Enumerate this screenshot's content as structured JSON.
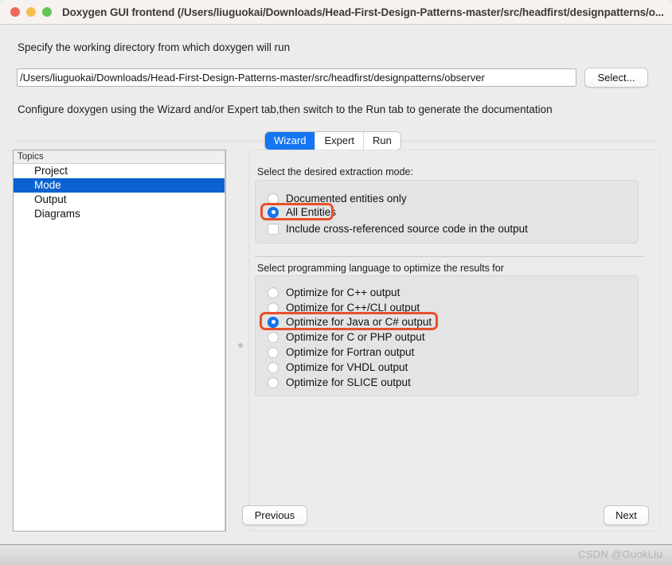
{
  "window": {
    "title": "Doxygen GUI frontend (/Users/liuguokai/Downloads/Head-First-Design-Patterns-master/src/headfirst/designpatterns/o...",
    "traffic_lights": [
      "close-red",
      "minimize-yellow",
      "maximize-green"
    ]
  },
  "form": {
    "directory_label": "Specify the working directory from which doxygen will run",
    "directory_value": "/Users/liuguokai/Downloads/Head-First-Design-Patterns-master/src/headfirst/designpatterns/observer",
    "directory_placeholder": "",
    "select_button": "Select...",
    "configure_hint": "Configure doxygen using the Wizard and/or Expert tab,then switch to the Run tab to generate the documentation"
  },
  "tabs": [
    {
      "label": "Wizard",
      "active": true
    },
    {
      "label": "Expert",
      "active": false
    },
    {
      "label": "Run",
      "active": false
    }
  ],
  "topics": {
    "header": "Topics",
    "items": [
      {
        "label": "Project",
        "selected": false
      },
      {
        "label": "Mode",
        "selected": true
      },
      {
        "label": "Output",
        "selected": false
      },
      {
        "label": "Diagrams",
        "selected": false
      }
    ]
  },
  "mode_section": {
    "caption": "Select the desired extraction mode:",
    "options": [
      {
        "label": "Documented entities only",
        "type": "radio",
        "checked": false,
        "highlighted": false
      },
      {
        "label": "All Entities",
        "type": "radio",
        "checked": true,
        "highlighted": true
      },
      {
        "label": "Include cross-referenced source code in the output",
        "type": "checkbox",
        "checked": false,
        "highlighted": false
      }
    ]
  },
  "language_section": {
    "caption": "Select programming language to optimize the results for",
    "options": [
      {
        "label": "Optimize for C++ output",
        "type": "radio",
        "checked": false,
        "highlighted": false
      },
      {
        "label": "Optimize for C++/CLI output",
        "type": "radio",
        "checked": false,
        "highlighted": false
      },
      {
        "label": "Optimize for Java or C# output",
        "type": "radio",
        "checked": true,
        "highlighted": true
      },
      {
        "label": "Optimize for C or PHP output",
        "type": "radio",
        "checked": false,
        "highlighted": false
      },
      {
        "label": "Optimize for Fortran output",
        "type": "radio",
        "checked": false,
        "highlighted": false
      },
      {
        "label": "Optimize for VHDL output",
        "type": "radio",
        "checked": false,
        "highlighted": false
      },
      {
        "label": "Optimize for SLICE output",
        "type": "radio",
        "checked": false,
        "highlighted": false
      }
    ]
  },
  "nav": {
    "previous": "Previous",
    "next": "Next"
  },
  "footer": {
    "watermark": "CSDN @GuokLiu"
  },
  "colors": {
    "accent_blue": "#1476f2",
    "selection_blue": "#0a62d0",
    "highlight_orange": "#e8512a",
    "window_background": "#ececec",
    "titlebar": "#f6f2ef"
  }
}
